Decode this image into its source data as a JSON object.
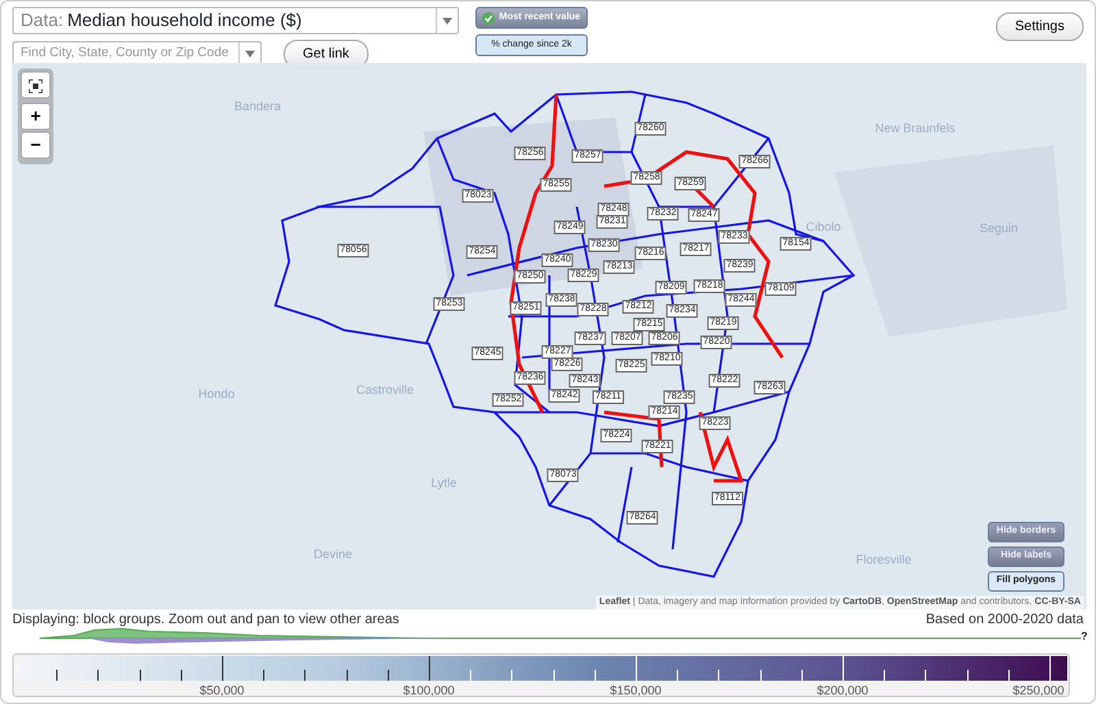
{
  "toolbar": {
    "data_select": {
      "prefix": "Data:",
      "value": "Median household income ($)"
    },
    "search": {
      "placeholder": "Find City, State, County or Zip Code"
    },
    "get_link": "Get link",
    "view_toggle": [
      {
        "label": "Most recent value",
        "selected": true
      },
      {
        "label": "% change since 2k",
        "selected": false
      }
    ],
    "settings": "Settings"
  },
  "map": {
    "zoom_controls": [
      "+",
      "−"
    ],
    "place_names": [
      "Bandera",
      "New Braunfels",
      "Cibolo",
      "Seguin",
      "Castroville",
      "Hondo",
      "Lytle",
      "Devine",
      "Floresville"
    ],
    "zip_labels": [
      "78260",
      "78256",
      "78257",
      "78266",
      "78258",
      "78255",
      "78259",
      "78023",
      "78248",
      "78232",
      "78247",
      "78231",
      "78249",
      "78233",
      "78154",
      "78056",
      "78230",
      "78254",
      "78216",
      "78217",
      "78240",
      "78213",
      "78239",
      "78250",
      "78229",
      "78209",
      "78218",
      "78109",
      "78238",
      "78244",
      "78253",
      "78251",
      "78228",
      "78212",
      "78234",
      "78215",
      "78219",
      "78237",
      "78207",
      "78206",
      "78220",
      "78245",
      "78227",
      "78210",
      "78226",
      "78225",
      "78236",
      "78243",
      "78222",
      "78263",
      "78252",
      "78242",
      "78211",
      "78235",
      "78214",
      "78223",
      "78224",
      "78221",
      "78073",
      "78112",
      "78264"
    ],
    "layer_buttons": [
      {
        "label": "Hide borders",
        "selected": true
      },
      {
        "label": "Hide labels",
        "selected": true
      },
      {
        "label": "Fill polygons",
        "selected": false
      }
    ],
    "attribution": {
      "link": "Leaflet",
      "text": "| Data, imagery and map information provided by **CartoDB**, **OpenStreetMap** and contributors, **CC-BY-SA**"
    }
  },
  "status": {
    "left": "Displaying: block groups. Zoom out and pan to view other areas",
    "right": "Based on 2000-2020 data",
    "help": "?"
  },
  "legend": {
    "tick_labels": [
      "$50,000",
      "$100,000",
      "$150,000",
      "$200,000",
      "$250,000"
    ]
  }
}
